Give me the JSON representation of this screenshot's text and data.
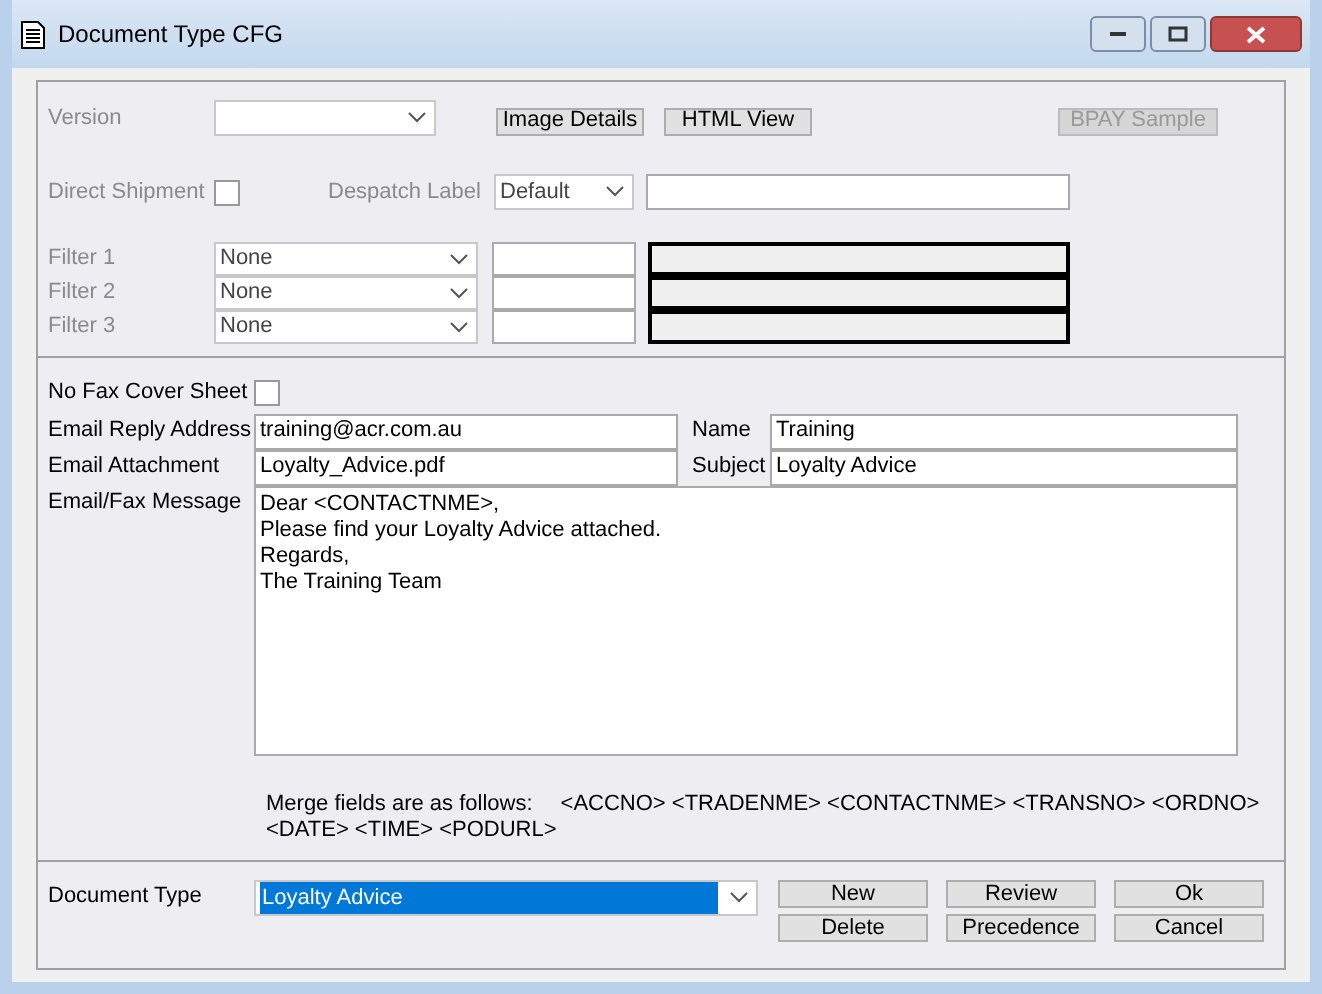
{
  "window": {
    "title": "Document Type CFG"
  },
  "settings": {
    "disabled": true,
    "version": {
      "label": "Version"
    },
    "top_buttons": [
      {
        "label": "Image Details",
        "disabled": false
      },
      {
        "label": "HTML View",
        "disabled": false
      },
      {
        "label": "BPAY Sample",
        "disabled": true
      }
    ],
    "direct_shipment": {
      "label": "Direct Shipment",
      "checked": false
    },
    "despatch_label": {
      "label": "Despatch Label",
      "value": "Default"
    },
    "filters": [
      {
        "label": "Filter 1",
        "value": "None"
      },
      {
        "label": "Filter 2",
        "value": "None"
      },
      {
        "label": "Filter 3",
        "value": "None"
      }
    ]
  },
  "email": {
    "no_fax_cover": {
      "label": "No Fax Cover Sheet",
      "checked": false
    },
    "reply_address": {
      "label": "Email Reply Address",
      "value": "training@acr.com.au"
    },
    "name": {
      "label": "Name",
      "value": "Training"
    },
    "attachment": {
      "label": "Email Attachment",
      "value": "Loyalty_Advice.pdf"
    },
    "subject": {
      "label": "Subject",
      "value": "Loyalty Advice"
    },
    "message": {
      "label": "Email/Fax Message",
      "lines": [
        "Dear <CONTACTNME>,",
        "Please find your Loyalty Advice attached.",
        "Regards,",
        "The Training Team"
      ]
    },
    "merge_note": {
      "label": "Merge fields are as follows:",
      "fields": "<ACCNO> <TRADENME> <CONTACTNME> <TRANSNO> <ORDNO>",
      "fields_line2": "<DATE> <TIME> <PODURL>"
    }
  },
  "document_type": {
    "label": "Document Type",
    "value": "Loyalty Advice",
    "selected": true
  },
  "buttons": [
    [
      "New",
      "Review",
      "Ok"
    ],
    [
      "Delete",
      "Precedence",
      "Cancel"
    ]
  ]
}
